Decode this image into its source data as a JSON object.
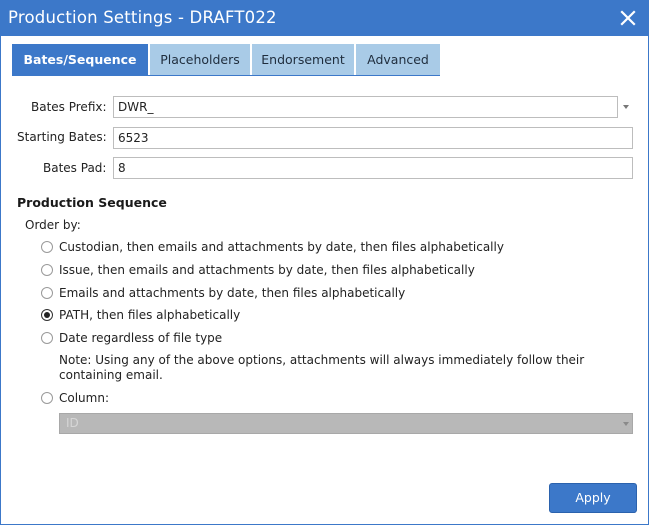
{
  "window": {
    "title": "Production Settings - DRAFT022"
  },
  "tabs": [
    {
      "label": "Bates/Sequence",
      "active": true
    },
    {
      "label": "Placeholders",
      "active": false
    },
    {
      "label": "Endorsement",
      "active": false
    },
    {
      "label": "Advanced",
      "active": false
    }
  ],
  "fields": {
    "bates_prefix": {
      "label": "Bates Prefix:",
      "value": "DWR_"
    },
    "starting_bates": {
      "label": "Starting Bates:",
      "value": "6523"
    },
    "bates_pad": {
      "label": "Bates Pad:",
      "value": "8"
    }
  },
  "sequence": {
    "title": "Production Sequence",
    "order_by_label": "Order by:",
    "options": [
      {
        "label": "Custodian, then emails and attachments by date, then files alphabetically",
        "selected": false
      },
      {
        "label": "Issue, then emails and attachments by date, then files alphabetically",
        "selected": false
      },
      {
        "label": "Emails and attachments by date, then files alphabetically",
        "selected": false
      },
      {
        "label": "PATH, then files alphabetically",
        "selected": true
      },
      {
        "label": "Date regardless of file type",
        "selected": false
      }
    ],
    "note": "Note: Using any of the above options, attachments will always immediately follow their containing email.",
    "column_option": {
      "label": "Column:",
      "selected": false
    },
    "column_value": "ID"
  },
  "actions": {
    "apply_label": "Apply"
  },
  "colors": {
    "accent": "#3c78c9",
    "tab_inactive": "#a9cbe7",
    "disabled_field": "#b8b8b8"
  }
}
